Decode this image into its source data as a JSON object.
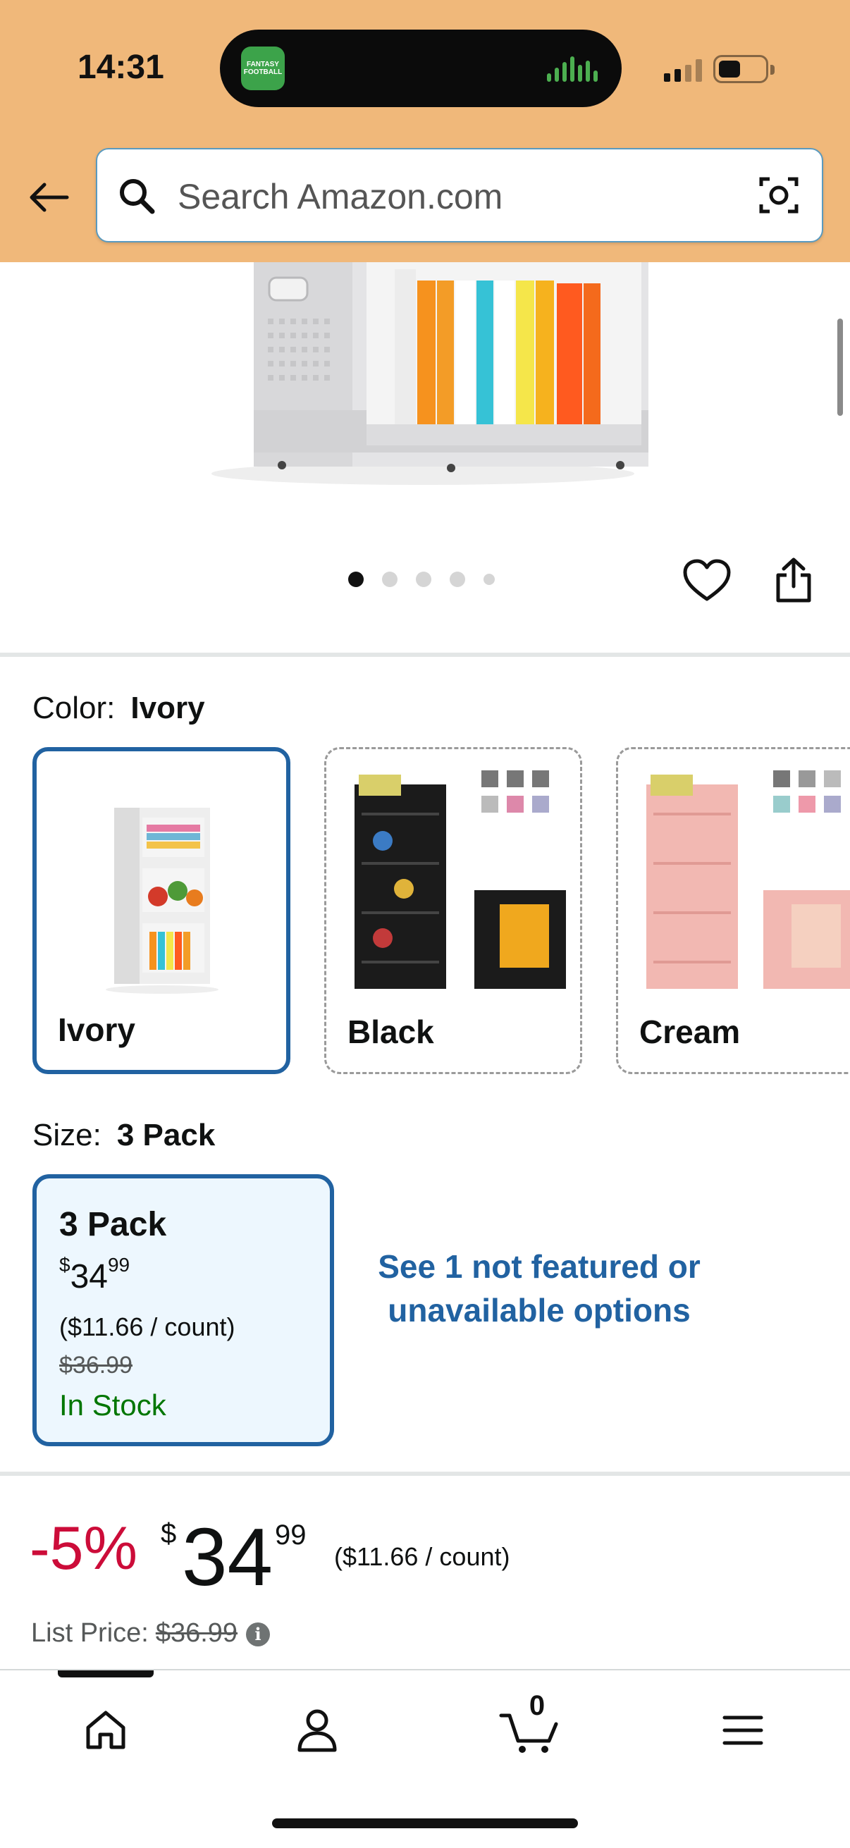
{
  "status_bar": {
    "time": "14:31",
    "live_activity_app": "FANTASY FOOTBALL"
  },
  "search": {
    "placeholder": "Search Amazon.com"
  },
  "gallery": {
    "dot_count": 5,
    "active_index": 0
  },
  "color": {
    "label": "Color:",
    "selected": "Ivory",
    "options": [
      {
        "label": "Ivory",
        "selected": true
      },
      {
        "label": "Black",
        "selected": false
      },
      {
        "label": "Cream",
        "selected": false
      }
    ]
  },
  "size": {
    "label": "Size:",
    "selected": "3 Pack",
    "card": {
      "name": "3 Pack",
      "price_currency": "$",
      "price_whole": "34",
      "price_fraction": "99",
      "per_unit": "($11.66 / count)",
      "was_price": "$36.99",
      "stock": "In Stock"
    },
    "unavailable_link": "See 1 not featured or unavailable options"
  },
  "price": {
    "discount": "-5%",
    "currency": "$",
    "whole": "34",
    "fraction": "99",
    "unit_price": "($11.66 / count)",
    "list_label": "List Price:",
    "list_value": "$36.99"
  },
  "bottom_nav": {
    "cart_count": "0",
    "items": [
      "home-icon",
      "account-icon",
      "cart-icon",
      "menu-icon"
    ]
  },
  "colors": {
    "header_bg": "#f0b87a",
    "accent_blue": "#2162a1",
    "discount_red": "#cc0c39",
    "stock_green": "#007600"
  }
}
